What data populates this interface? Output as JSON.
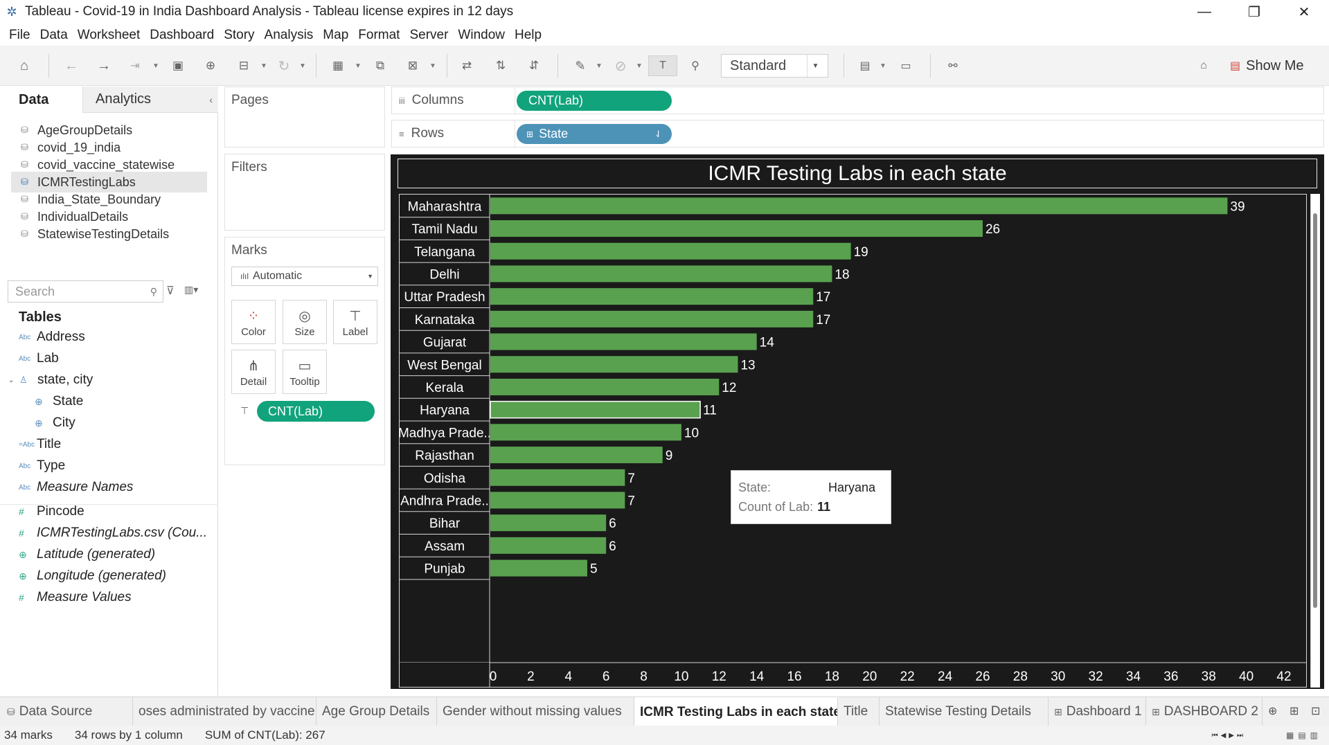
{
  "window": {
    "title": "Tableau - Covid-19 in India Dashboard Analysis - Tableau license expires in 12 days",
    "controls": [
      "—",
      "❐",
      "✕"
    ]
  },
  "menu": [
    "File",
    "Data",
    "Worksheet",
    "Dashboard",
    "Story",
    "Analysis",
    "Map",
    "Format",
    "Server",
    "Window",
    "Help"
  ],
  "toolbar": {
    "fit_mode": "Standard",
    "show_me": "Show Me"
  },
  "left_pane": {
    "tab_data": "Data",
    "tab_analytics": "Analytics",
    "data_sources": [
      {
        "label": "AgeGroupDetails",
        "selected": false
      },
      {
        "label": "covid_19_india",
        "selected": false
      },
      {
        "label": "covid_vaccine_statewise",
        "selected": false
      },
      {
        "label": "ICMRTestingLabs",
        "selected": true
      },
      {
        "label": "India_State_Boundary",
        "selected": false
      },
      {
        "label": "IndividualDetails",
        "selected": false
      },
      {
        "label": "StatewiseTestingDetails",
        "selected": false
      }
    ],
    "search_placeholder": "Search",
    "tables_heading": "Tables",
    "dimensions": [
      {
        "label": "Address",
        "icon": "Abc"
      },
      {
        "label": "Lab",
        "icon": "Abc"
      },
      {
        "label": "state, city",
        "icon": "hierarchy"
      },
      {
        "label": "State",
        "icon": "globe"
      },
      {
        "label": "City",
        "icon": "globe"
      },
      {
        "label": "Title",
        "icon": "Abc"
      },
      {
        "label": "Type",
        "icon": "Abc"
      },
      {
        "label": "Measure Names",
        "icon": "Abc"
      }
    ],
    "measures": [
      {
        "label": "Pincode",
        "icon": "#"
      },
      {
        "label": "ICMRTestingLabs.csv (Cou...",
        "icon": "#"
      },
      {
        "label": "Latitude (generated)",
        "icon": "globe"
      },
      {
        "label": "Longitude (generated)",
        "icon": "globe"
      },
      {
        "label": "Measure Values",
        "icon": "#"
      }
    ]
  },
  "cards": {
    "pages": "Pages",
    "filters": "Filters",
    "marks": "Marks",
    "mark_type": "Automatic",
    "mark_buttons": [
      "Color",
      "Size",
      "Label",
      "Detail",
      "Tooltip"
    ],
    "marks_pill": "CNT(Lab)"
  },
  "shelves": {
    "columns_label": "Columns",
    "columns_pill": "CNT(Lab)",
    "rows_label": "Rows",
    "rows_pill": "State"
  },
  "chart_data": {
    "type": "bar",
    "orientation": "horizontal",
    "title": "ICMR Testing Labs in each state",
    "categories": [
      "Maharashtra",
      "Tamil Nadu",
      "Telangana",
      "Delhi",
      "Uttar Pradesh",
      "Karnataka",
      "Gujarat",
      "West Bengal",
      "Kerala",
      "Haryana",
      "Madhya Prade..",
      "Rajasthan",
      "Odisha",
      "Andhra Prade..",
      "Bihar",
      "Assam",
      "Punjab"
    ],
    "values": [
      39,
      26,
      19,
      18,
      17,
      17,
      14,
      13,
      12,
      11,
      10,
      9,
      7,
      7,
      6,
      6,
      5
    ],
    "highlighted": "Haryana",
    "xlim": [
      0,
      42
    ],
    "xticks": [
      0,
      2,
      4,
      6,
      8,
      10,
      12,
      14,
      16,
      18,
      20,
      22,
      24,
      26,
      28,
      30,
      32,
      34,
      36,
      38,
      40,
      42
    ],
    "bar_color": "#59a14f",
    "background": "#1a1a1a"
  },
  "tooltip": {
    "state_key": "State:",
    "state_value": "Haryana",
    "count_key": "Count of Lab:",
    "count_value": "11"
  },
  "sheet_tabs": [
    {
      "label": "Data Source",
      "active": false
    },
    {
      "label": "oses administrated by vaccine",
      "active": false
    },
    {
      "label": "Age Group Details",
      "active": false
    },
    {
      "label": "Gender without missing values",
      "active": false
    },
    {
      "label": "ICMR Testing Labs in each state",
      "active": true
    },
    {
      "label": "Title",
      "active": false
    },
    {
      "label": "Statewise Testing Details",
      "active": false
    },
    {
      "label": "Dashboard 1",
      "active": false
    },
    {
      "label": "DASHBOARD 2",
      "active": false
    }
  ],
  "status": {
    "marks": "34 marks",
    "rows": "34 rows by 1 column",
    "sum": "SUM of CNT(Lab): 267"
  }
}
